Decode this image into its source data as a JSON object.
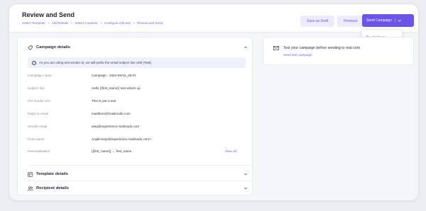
{
  "header": {
    "title": "Review and Send",
    "breadcrumb": [
      "Select Template",
      "Add Details",
      "Select Contacts",
      "Configure A/B test",
      "Review and Send"
    ],
    "breadcrumb_sep": ">",
    "save_draft": "Save as Draft",
    "previous": "Previous",
    "send_campaign": "Send Campaign",
    "send_divider": "|"
  },
  "dropdown": {
    "items": [
      "Send now",
      "Schedule options"
    ]
  },
  "campaign": {
    "title": "Campaign details",
    "info": "As you are using test sender id, we will prefix the email subject line with [Test].",
    "rows": [
      {
        "label": "Campaign name",
        "value": "Campaign - 2024-09-02_05:57"
      },
      {
        "label": "Subject line",
        "value": "Hello {{first_name}} test what's up"
      },
      {
        "label": "Pre-header text",
        "value": "This is just a test"
      },
      {
        "label": "Reply to email",
        "value": "mashkoor@mailmodo.com"
      },
      {
        "label": "Sender email",
        "value": "amp@experience.mailmodo.com"
      },
      {
        "label": "From name",
        "value": "Anjali<amp@experience.mailmodo.com>"
      },
      {
        "label": "Personalisation",
        "value": "{{first_name}}  →  first_name"
      }
    ],
    "view_all": "View all"
  },
  "template_section": {
    "title": "Template details"
  },
  "recipient_section": {
    "title": "Recipient details"
  },
  "test_panel": {
    "text": "Test your campaign before sending to real cont",
    "link": "Send test campaign"
  },
  "colors": {
    "accent": "#6a55e8",
    "link": "#7c5cf4"
  }
}
